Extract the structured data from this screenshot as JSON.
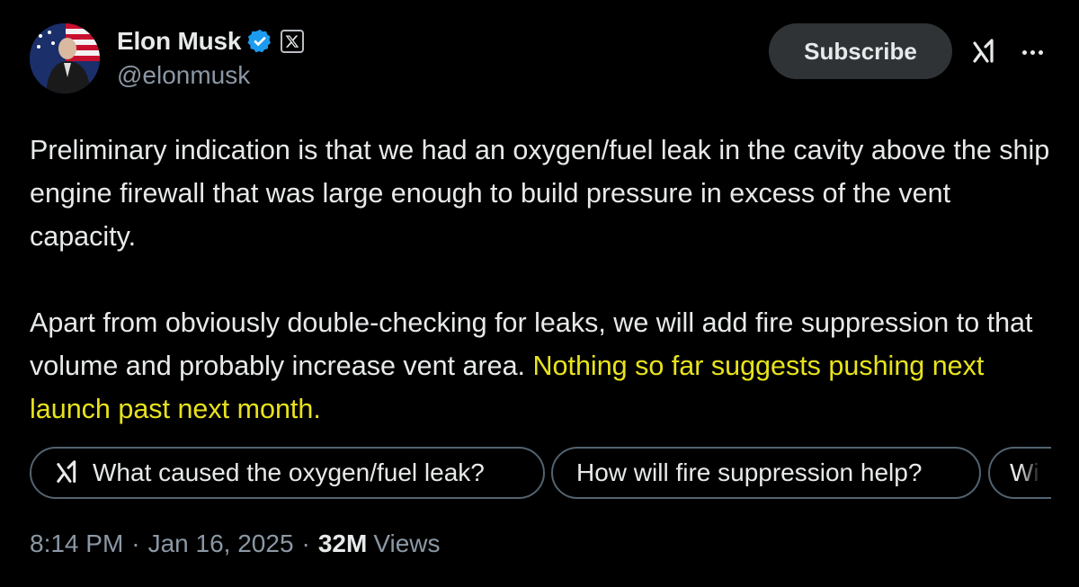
{
  "author": {
    "display_name": "Elon Musk",
    "handle": "@elonmusk"
  },
  "actions": {
    "subscribe_label": "Subscribe"
  },
  "tweet": {
    "paragraph1": "Preliminary indication is that we had an oxygen/fuel leak in the cavity above the ship engine firewall that was large enough to build pressure in excess of the vent capacity.",
    "paragraph2_plain": "Apart from obviously double-checking for leaks, we will add fire suppression to that volume and probably increase vent area. ",
    "paragraph2_highlight": "Nothing so far suggests pushing next launch past next month."
  },
  "suggestions": [
    {
      "label": "What caused the oxygen/fuel leak?",
      "icon": "grok-icon"
    },
    {
      "label": "How will fire suppression help?"
    },
    {
      "label": "Wil"
    }
  ],
  "meta": {
    "time": "8:14 PM",
    "date": "Jan 16, 2025",
    "separator": "·",
    "views_count": "32M",
    "views_label": "Views"
  },
  "colors": {
    "background": "#000000",
    "text": "#e7e9ea",
    "muted": "#8b98a5",
    "verified": "#1d9bf0",
    "highlight": "#e8e31c",
    "button_bg": "#2f3336",
    "chip_border": "#536471"
  },
  "icons": [
    "verified-badge-icon",
    "x-logo-icon",
    "grok-icon",
    "more-icon"
  ]
}
